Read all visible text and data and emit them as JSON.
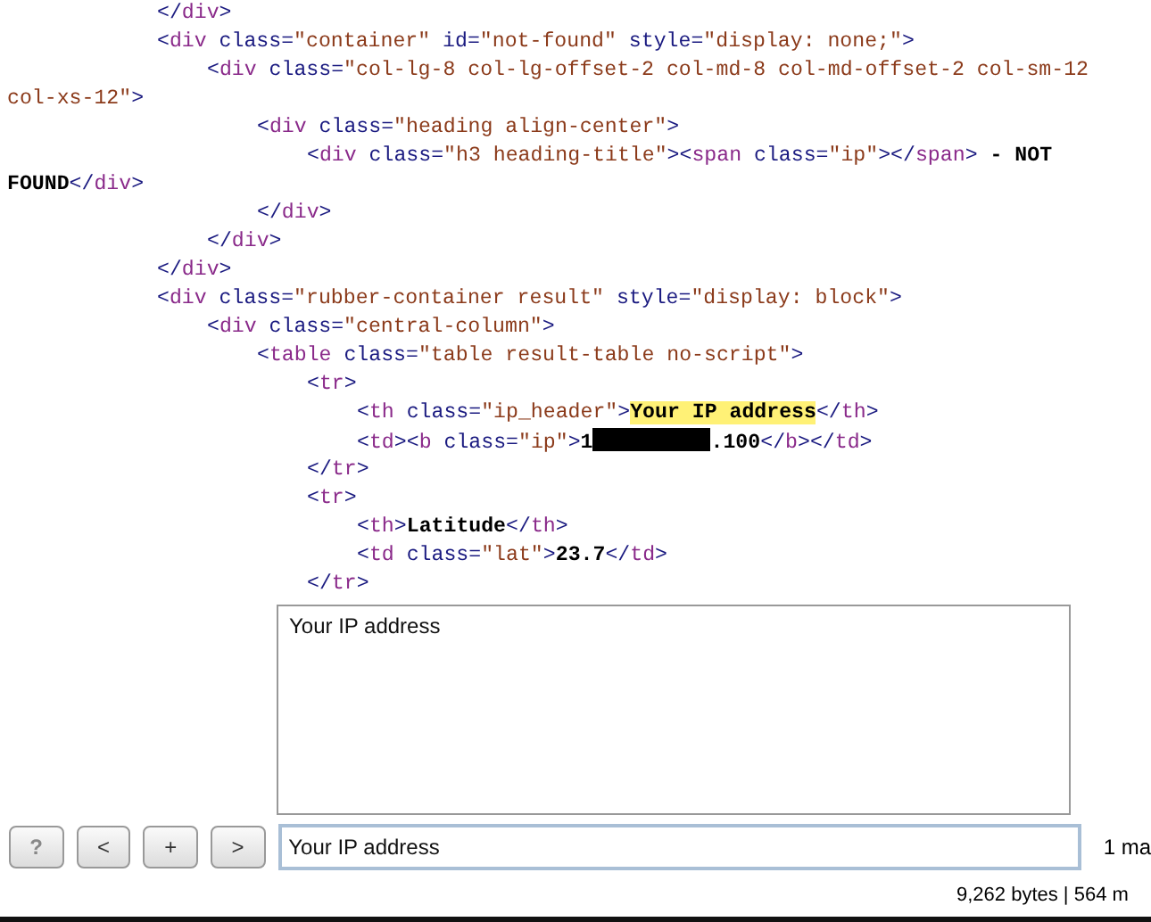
{
  "code_lines": [
    {
      "tokens": [
        {
          "kind": "p",
          "text": "</"
        },
        {
          "kind": "tag",
          "text": "div"
        },
        {
          "kind": "p",
          "text": ">"
        }
      ]
    },
    {
      "tokens": [
        {
          "kind": "p",
          "text": "<"
        },
        {
          "kind": "tag",
          "text": "div"
        },
        {
          "kind": "p",
          "text": " class="
        },
        {
          "kind": "val",
          "text": "\"container\""
        },
        {
          "kind": "p",
          "text": " id="
        },
        {
          "kind": "val",
          "text": "\"not-found\""
        },
        {
          "kind": "p",
          "text": " style="
        },
        {
          "kind": "val",
          "text": "\"display: none;\""
        },
        {
          "kind": "p",
          "text": ">"
        }
      ],
      "children": [
        {
          "tokens": [
            {
              "kind": "p",
              "text": "<"
            },
            {
              "kind": "tag",
              "text": "div"
            },
            {
              "kind": "p",
              "text": " class="
            },
            {
              "kind": "val",
              "text": "\"col-lg-8 col-lg-offset-2 col-md-8 col-md-offset-2 col-sm-12"
            }
          ],
          "children": [
            {
              "kind": "wrap",
              "tokens": [
                {
                  "kind": "val",
                  "text": "col-xs-12\""
                },
                {
                  "kind": "p",
                  "text": ">"
                }
              ]
            },
            {
              "tokens": [
                {
                  "kind": "p",
                  "text": "<"
                },
                {
                  "kind": "tag",
                  "text": "div"
                },
                {
                  "kind": "p",
                  "text": " class="
                },
                {
                  "kind": "val",
                  "text": "\"heading align-center\""
                },
                {
                  "kind": "p",
                  "text": ">"
                }
              ],
              "children": [
                {
                  "tokens": [
                    {
                      "kind": "p",
                      "text": "<"
                    },
                    {
                      "kind": "tag",
                      "text": "div"
                    },
                    {
                      "kind": "p",
                      "text": " class="
                    },
                    {
                      "kind": "val",
                      "text": "\"h3 heading-title\""
                    },
                    {
                      "kind": "p",
                      "text": "><"
                    },
                    {
                      "kind": "tag",
                      "text": "span"
                    },
                    {
                      "kind": "p",
                      "text": " class="
                    },
                    {
                      "kind": "val",
                      "text": "\"ip\""
                    },
                    {
                      "kind": "p",
                      "text": "></"
                    },
                    {
                      "kind": "tag",
                      "text": "span"
                    },
                    {
                      "kind": "p",
                      "text": ">"
                    },
                    {
                      "kind": "text",
                      "text": " - NOT"
                    }
                  ]
                },
                {
                  "kind": "wrap",
                  "tokens": [
                    {
                      "kind": "text",
                      "text": "FOUND"
                    },
                    {
                      "kind": "p",
                      "text": "</"
                    },
                    {
                      "kind": "tag",
                      "text": "div"
                    },
                    {
                      "kind": "p",
                      "text": ">"
                    }
                  ]
                }
              ]
            },
            {
              "tokens": [
                {
                  "kind": "p",
                  "text": "</"
                },
                {
                  "kind": "tag",
                  "text": "div"
                },
                {
                  "kind": "p",
                  "text": ">"
                }
              ]
            }
          ]
        },
        {
          "tokens": [
            {
              "kind": "p",
              "text": "</"
            },
            {
              "kind": "tag",
              "text": "div"
            },
            {
              "kind": "p",
              "text": ">"
            }
          ]
        }
      ]
    },
    {
      "tokens": [
        {
          "kind": "p",
          "text": "</"
        },
        {
          "kind": "tag",
          "text": "div"
        },
        {
          "kind": "p",
          "text": ">"
        }
      ]
    },
    {
      "tokens": [
        {
          "kind": "p",
          "text": "<"
        },
        {
          "kind": "tag",
          "text": "div"
        },
        {
          "kind": "p",
          "text": " class="
        },
        {
          "kind": "val",
          "text": "\"rubber-container result\""
        },
        {
          "kind": "p",
          "text": " style="
        },
        {
          "kind": "val",
          "text": "\"display: block\""
        },
        {
          "kind": "p",
          "text": ">"
        }
      ],
      "children": [
        {
          "tokens": [
            {
              "kind": "p",
              "text": "<"
            },
            {
              "kind": "tag",
              "text": "div"
            },
            {
              "kind": "p",
              "text": " class="
            },
            {
              "kind": "val",
              "text": "\"central-column\""
            },
            {
              "kind": "p",
              "text": ">"
            }
          ],
          "children": [
            {
              "tokens": [
                {
                  "kind": "p",
                  "text": "<"
                },
                {
                  "kind": "tag",
                  "text": "table"
                },
                {
                  "kind": "p",
                  "text": " class="
                },
                {
                  "kind": "val",
                  "text": "\"table result-table no-script\""
                },
                {
                  "kind": "p",
                  "text": ">"
                }
              ],
              "children": [
                {
                  "tokens": [
                    {
                      "kind": "p",
                      "text": "<"
                    },
                    {
                      "kind": "tag",
                      "text": "tr"
                    },
                    {
                      "kind": "p",
                      "text": ">"
                    }
                  ],
                  "children": [
                    {
                      "tokens": [
                        {
                          "kind": "p",
                          "text": "<"
                        },
                        {
                          "kind": "tag",
                          "text": "th"
                        },
                        {
                          "kind": "p",
                          "text": " class="
                        },
                        {
                          "kind": "val",
                          "text": "\"ip_header\""
                        },
                        {
                          "kind": "p",
                          "text": ">"
                        },
                        {
                          "kind": "hl",
                          "text": "Your IP address"
                        },
                        {
                          "kind": "p",
                          "text": "</"
                        },
                        {
                          "kind": "tag",
                          "text": "th"
                        },
                        {
                          "kind": "p",
                          "text": ">"
                        }
                      ]
                    },
                    {
                      "tokens": [
                        {
                          "kind": "p",
                          "text": "<"
                        },
                        {
                          "kind": "tag",
                          "text": "td"
                        },
                        {
                          "kind": "p",
                          "text": "><"
                        },
                        {
                          "kind": "tag",
                          "text": "b"
                        },
                        {
                          "kind": "p",
                          "text": " class="
                        },
                        {
                          "kind": "val",
                          "text": "\"ip\""
                        },
                        {
                          "kind": "p",
                          "text": ">"
                        },
                        {
                          "kind": "text",
                          "text": "1"
                        },
                        {
                          "kind": "redacted"
                        },
                        {
                          "kind": "text",
                          "text": ".100"
                        },
                        {
                          "kind": "p",
                          "text": "</"
                        },
                        {
                          "kind": "tag",
                          "text": "b"
                        },
                        {
                          "kind": "p",
                          "text": "></"
                        },
                        {
                          "kind": "tag",
                          "text": "td"
                        },
                        {
                          "kind": "p",
                          "text": ">"
                        }
                      ]
                    }
                  ]
                },
                {
                  "tokens": [
                    {
                      "kind": "p",
                      "text": "</"
                    },
                    {
                      "kind": "tag",
                      "text": "tr"
                    },
                    {
                      "kind": "p",
                      "text": ">"
                    }
                  ]
                },
                {
                  "tokens": [
                    {
                      "kind": "p",
                      "text": "<"
                    },
                    {
                      "kind": "tag",
                      "text": "tr"
                    },
                    {
                      "kind": "p",
                      "text": ">"
                    }
                  ],
                  "children": [
                    {
                      "tokens": [
                        {
                          "kind": "p",
                          "text": "<"
                        },
                        {
                          "kind": "tag",
                          "text": "th"
                        },
                        {
                          "kind": "p",
                          "text": ">"
                        },
                        {
                          "kind": "text",
                          "text": "Latitude"
                        },
                        {
                          "kind": "p",
                          "text": "</"
                        },
                        {
                          "kind": "tag",
                          "text": "th"
                        },
                        {
                          "kind": "p",
                          "text": ">"
                        }
                      ]
                    },
                    {
                      "tokens": [
                        {
                          "kind": "p",
                          "text": "<"
                        },
                        {
                          "kind": "tag",
                          "text": "td"
                        },
                        {
                          "kind": "p",
                          "text": " class="
                        },
                        {
                          "kind": "val",
                          "text": "\"lat\""
                        },
                        {
                          "kind": "p",
                          "text": ">"
                        },
                        {
                          "kind": "text",
                          "text": "23.7"
                        },
                        {
                          "kind": "p",
                          "text": "</"
                        },
                        {
                          "kind": "tag",
                          "text": "td"
                        },
                        {
                          "kind": "p",
                          "text": ">"
                        }
                      ]
                    }
                  ]
                },
                {
                  "tokens": [
                    {
                      "kind": "p",
                      "text": "</"
                    },
                    {
                      "kind": "tag",
                      "text": "tr"
                    },
                    {
                      "kind": "p",
                      "text": ">"
                    }
                  ]
                }
              ]
            }
          ]
        }
      ]
    }
  ],
  "preview_text": "Your IP address",
  "buttons": [
    {
      "label": "?",
      "kind": "help"
    },
    {
      "label": "<",
      "kind": "nav"
    },
    {
      "label": "+",
      "kind": "nav"
    },
    {
      "label": ">",
      "kind": "nav"
    }
  ],
  "search": {
    "value": "Your IP address"
  },
  "match_count": "1 ma",
  "status": "9,262 bytes | 564 m"
}
